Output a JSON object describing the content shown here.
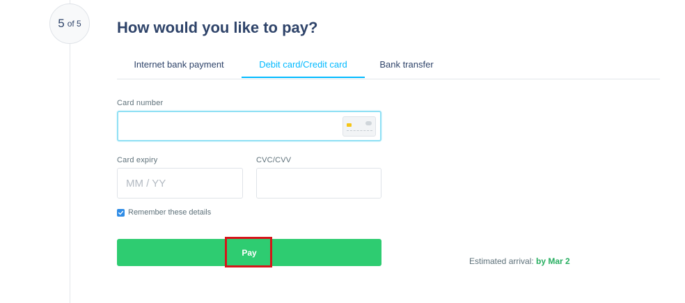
{
  "step": {
    "current": "5",
    "of_label": "of 5"
  },
  "title": "How would you like to pay?",
  "tabs": [
    {
      "label": "Internet bank payment",
      "active": false
    },
    {
      "label": "Debit card/Credit card",
      "active": true
    },
    {
      "label": "Bank transfer",
      "active": false
    }
  ],
  "card": {
    "number_label": "Card number",
    "number_value": "",
    "card_icon": "credit-card-icon"
  },
  "expiry": {
    "label": "Card expiry",
    "placeholder": "MM / YY",
    "value": ""
  },
  "cvc": {
    "label": "CVC/CVV",
    "value": ""
  },
  "remember": {
    "label": "Remember these details",
    "checked": true
  },
  "pay_button": {
    "label": "Pay"
  },
  "arrival": {
    "prefix": "Estimated arrival:",
    "date": "by Mar 2"
  },
  "colors": {
    "accent": "#00b9ff",
    "pay_green": "#2ecc71",
    "arrival_green": "#27ae60",
    "highlight_red": "#d7141a",
    "heading": "#2e4369"
  }
}
